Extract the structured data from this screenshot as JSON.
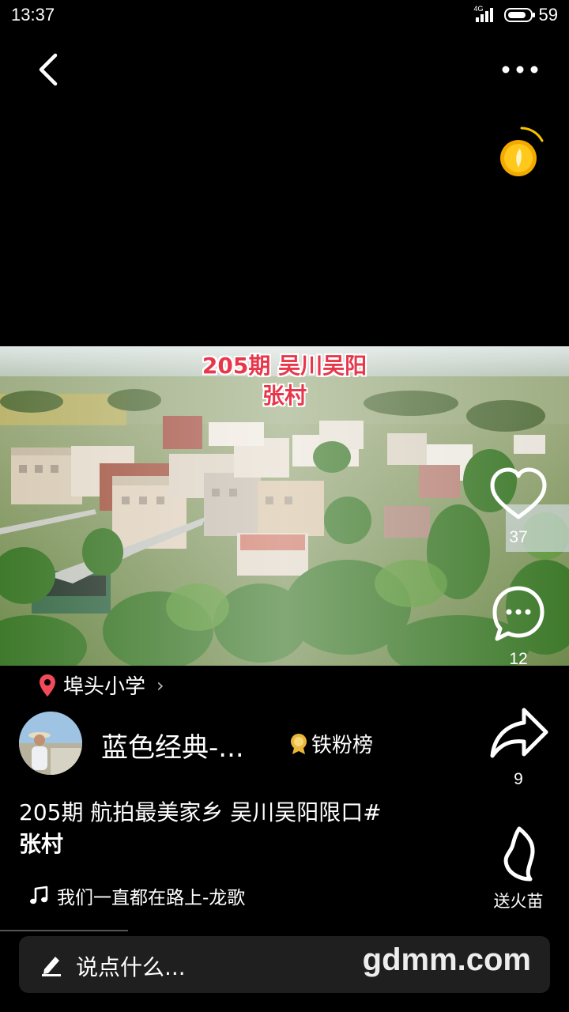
{
  "status_bar": {
    "time": "13:37",
    "network": "4G",
    "battery": "59"
  },
  "video": {
    "caption_line1": "205期 吴川吴阳",
    "caption_line2": "张村"
  },
  "actions": {
    "like_count": "37",
    "comment_count": "12",
    "share_count": "9",
    "fire_label": "送火苗"
  },
  "location": {
    "name": "埠头小学"
  },
  "author": {
    "name": "蓝色经典-...",
    "badge": "铁粉榜"
  },
  "description": {
    "text": "205期 航拍最美家乡  吴川吴阳限口#",
    "tag": "张村"
  },
  "music": {
    "title": "我们一直都在路上-龙歌"
  },
  "comment_input": {
    "placeholder": "说点什么...",
    "watermark": "gdmm.com"
  },
  "icons": [
    "back-icon",
    "more-icon",
    "coin-icon",
    "heart-icon",
    "comment-icon",
    "share-icon",
    "fire-icon",
    "location-pin-icon",
    "music-note-icon",
    "pen-icon",
    "medal-icon"
  ],
  "colors": {
    "background": "#000000",
    "caption_red": "#e8364b",
    "pin_red": "#f24a5a",
    "coin_gold": "#f6b400"
  }
}
